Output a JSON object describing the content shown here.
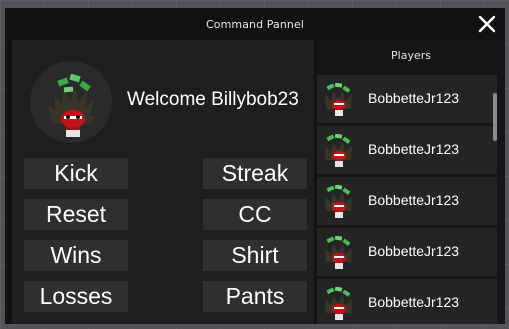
{
  "window": {
    "title": "Command Pannel",
    "close_icon": "close-icon"
  },
  "profile": {
    "welcome_text": "Welcome Billybob23",
    "avatar_icon": "avatar-icon"
  },
  "commands": [
    {
      "label": "Kick"
    },
    {
      "label": "Streak"
    },
    {
      "label": "Reset"
    },
    {
      "label": "CC"
    },
    {
      "label": "Wins"
    },
    {
      "label": "Shirt"
    },
    {
      "label": "Losses"
    },
    {
      "label": "Pants"
    }
  ],
  "players": {
    "header": "Players",
    "items": [
      {
        "name": "BobbetteJr123"
      },
      {
        "name": "BobbetteJr123"
      },
      {
        "name": "BobbetteJr123"
      },
      {
        "name": "BobbetteJr123"
      },
      {
        "name": "BobbetteJr123"
      }
    ]
  },
  "colors": {
    "panel_bg": "#111112",
    "section_bg": "#1e1e1f",
    "button_bg": "#2f2f30",
    "row_bg": "#242425",
    "text": "#ffffff"
  }
}
